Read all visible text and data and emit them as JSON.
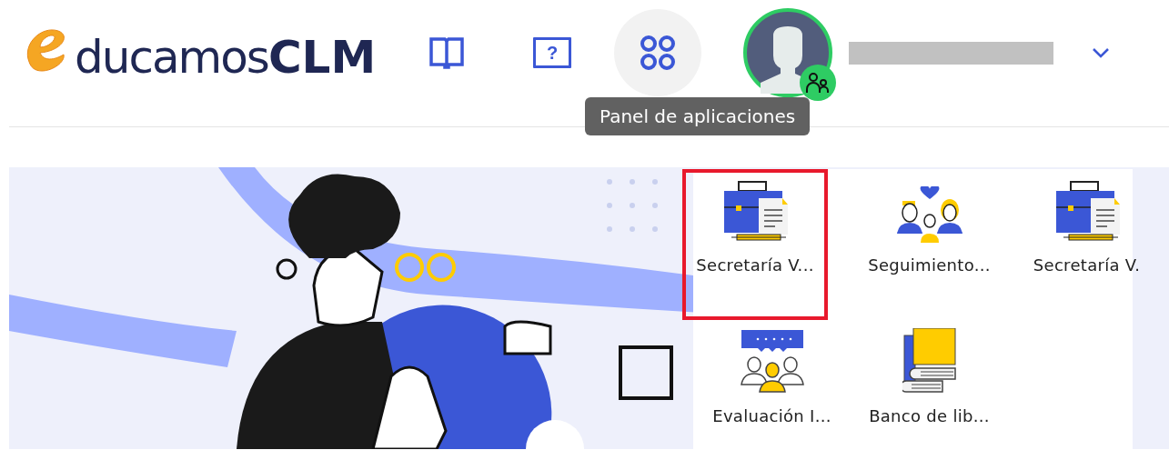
{
  "header": {
    "logo": {
      "prefix": "ducamos",
      "suffix": "CLM"
    },
    "nav": [
      {
        "kind": "book",
        "selected": false
      },
      {
        "kind": "help",
        "glyph": "?",
        "selected": false
      },
      {
        "kind": "apps",
        "selected": true
      }
    ],
    "tooltip": "Panel de aplicaciones",
    "user": {
      "name_redacted": true
    }
  },
  "apps_panel": {
    "items": [
      {
        "kind": "briefcase",
        "label": "Secretaría V...",
        "highlighted": true
      },
      {
        "kind": "family",
        "label": "Seguimiento...",
        "highlighted": false
      },
      {
        "kind": "briefcase",
        "label": "Secretaría V.",
        "highlighted": false
      },
      {
        "kind": "meeting",
        "label": "Evaluación I...",
        "highlighted": false
      },
      {
        "kind": "books",
        "label": "Banco de lib...",
        "highlighted": false
      }
    ]
  }
}
